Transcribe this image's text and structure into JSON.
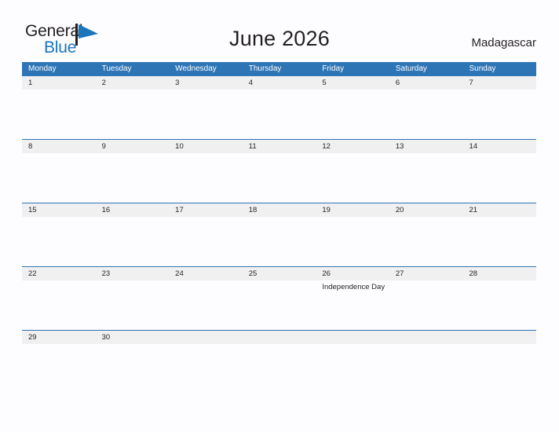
{
  "brand": {
    "name_part1": "General",
    "name_part2": "Blue",
    "mark_icon": "blue-flag-triangle-icon",
    "color_primary": "#1a75bb",
    "color_text": "#231f20"
  },
  "header": {
    "title": "June 2026",
    "country": "Madagascar"
  },
  "theme": {
    "header_blue": "#2e75b6",
    "row_band_gray": "#f0f0f0",
    "page_background": "#fdfdff",
    "divider_blue": "#2e75b6"
  },
  "calendar": {
    "month": "June",
    "year": "2026",
    "weekday_headers": [
      "Monday",
      "Tuesday",
      "Wednesday",
      "Thursday",
      "Friday",
      "Saturday",
      "Sunday"
    ],
    "weeks": [
      [
        {
          "day": "1",
          "event": ""
        },
        {
          "day": "2",
          "event": ""
        },
        {
          "day": "3",
          "event": ""
        },
        {
          "day": "4",
          "event": ""
        },
        {
          "day": "5",
          "event": ""
        },
        {
          "day": "6",
          "event": ""
        },
        {
          "day": "7",
          "event": ""
        }
      ],
      [
        {
          "day": "8",
          "event": ""
        },
        {
          "day": "9",
          "event": ""
        },
        {
          "day": "10",
          "event": ""
        },
        {
          "day": "11",
          "event": ""
        },
        {
          "day": "12",
          "event": ""
        },
        {
          "day": "13",
          "event": ""
        },
        {
          "day": "14",
          "event": ""
        }
      ],
      [
        {
          "day": "15",
          "event": ""
        },
        {
          "day": "16",
          "event": ""
        },
        {
          "day": "17",
          "event": ""
        },
        {
          "day": "18",
          "event": ""
        },
        {
          "day": "19",
          "event": ""
        },
        {
          "day": "20",
          "event": ""
        },
        {
          "day": "21",
          "event": ""
        }
      ],
      [
        {
          "day": "22",
          "event": ""
        },
        {
          "day": "23",
          "event": ""
        },
        {
          "day": "24",
          "event": ""
        },
        {
          "day": "25",
          "event": ""
        },
        {
          "day": "26",
          "event": "Independence Day"
        },
        {
          "day": "27",
          "event": ""
        },
        {
          "day": "28",
          "event": ""
        }
      ],
      [
        {
          "day": "29",
          "event": ""
        },
        {
          "day": "30",
          "event": ""
        },
        {
          "day": "",
          "event": ""
        },
        {
          "day": "",
          "event": ""
        },
        {
          "day": "",
          "event": ""
        },
        {
          "day": "",
          "event": ""
        },
        {
          "day": "",
          "event": ""
        }
      ]
    ]
  }
}
